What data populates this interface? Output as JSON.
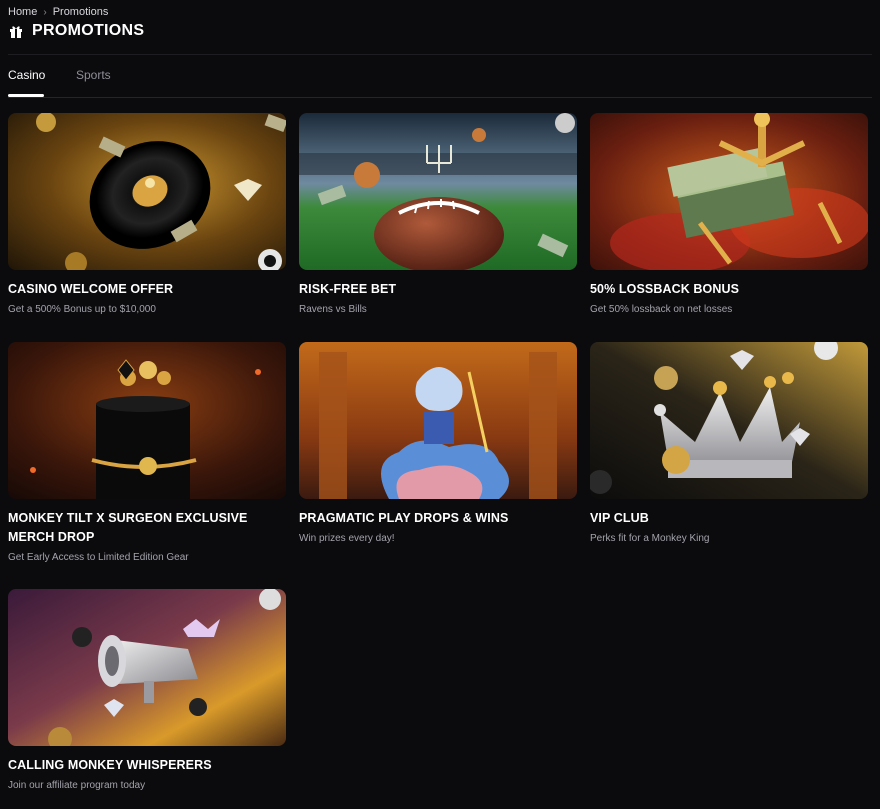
{
  "breadcrumb": {
    "home": "Home",
    "separator": "›",
    "current": "Promotions"
  },
  "page": {
    "title": "PROMOTIONS",
    "icon": "gift-icon"
  },
  "tabs": [
    {
      "label": "Casino",
      "active": true
    },
    {
      "label": "Sports",
      "active": false
    }
  ],
  "promotions": [
    {
      "title": "CASINO WELCOME OFFER",
      "subtitle": "Get a 500% Bonus up to $10,000",
      "image": "roulette-wheel-with-coins"
    },
    {
      "title": "RISK-FREE BET",
      "subtitle": "Ravens vs Bills",
      "image": "football-stadium"
    },
    {
      "title": "50% LOSSBACK BONUS",
      "subtitle": "Get 50% lossback on net losses",
      "image": "cash-stack-claw"
    },
    {
      "title": "MONKEY TILT X SURGEON EXCLUSIVE MERCH DROP",
      "subtitle": "Get Early Access to Limited Edition Gear",
      "image": "gold-jewelry-pedestal"
    },
    {
      "title": "PRAGMATIC PLAY DROPS & WINS",
      "subtitle": "Win prizes every day!",
      "image": "zeus-on-clouds"
    },
    {
      "title": "VIP CLUB",
      "subtitle": "Perks fit for a Monkey King",
      "image": "silver-crown"
    },
    {
      "title": "CALLING MONKEY WHISPERERS",
      "subtitle": "Join our affiliate program today",
      "image": "megaphone"
    }
  ],
  "colors": {
    "background": "#0b0b0e",
    "text": "#ffffff",
    "muted": "#a3a3ab",
    "gold": "#d9a441"
  }
}
